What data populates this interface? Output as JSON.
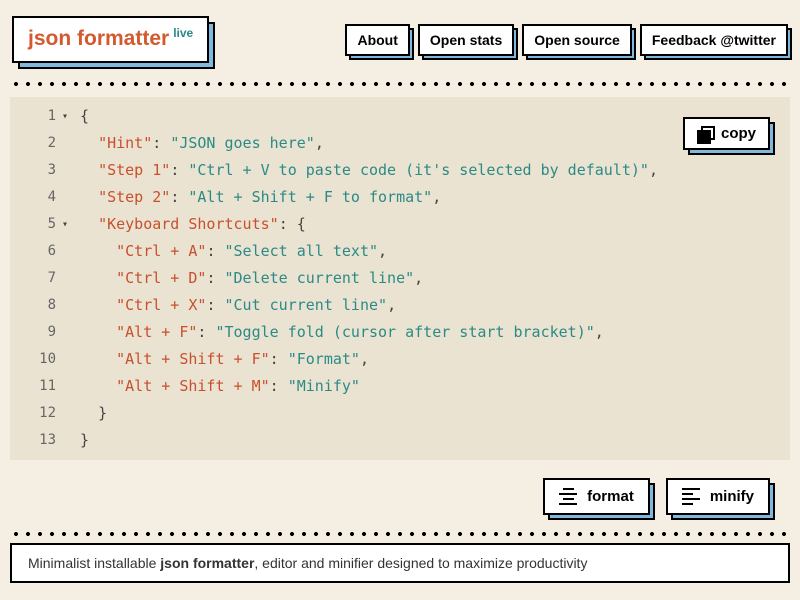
{
  "header": {
    "logo_text": "json formatter",
    "logo_sup": "live"
  },
  "nav": {
    "about": "About",
    "stats": "Open stats",
    "source": "Open source",
    "feedback": "Feedback @twitter"
  },
  "editor": {
    "copy_label": "copy",
    "lines": [
      {
        "num": "1",
        "fold": true,
        "indent": 0,
        "tokens": [
          {
            "t": "p",
            "v": "{"
          }
        ]
      },
      {
        "num": "2",
        "indent": 1,
        "tokens": [
          {
            "t": "k",
            "v": "\"Hint\""
          },
          {
            "t": "p",
            "v": ": "
          },
          {
            "t": "s",
            "v": "\"JSON goes here\""
          },
          {
            "t": "p",
            "v": ","
          }
        ]
      },
      {
        "num": "3",
        "indent": 1,
        "tokens": [
          {
            "t": "k",
            "v": "\"Step 1\""
          },
          {
            "t": "p",
            "v": ": "
          },
          {
            "t": "s",
            "v": "\"Ctrl + V to paste code (it's selected by default)\""
          },
          {
            "t": "p",
            "v": ","
          }
        ]
      },
      {
        "num": "4",
        "indent": 1,
        "tokens": [
          {
            "t": "k",
            "v": "\"Step 2\""
          },
          {
            "t": "p",
            "v": ": "
          },
          {
            "t": "s",
            "v": "\"Alt + Shift + F to format\""
          },
          {
            "t": "p",
            "v": ","
          }
        ]
      },
      {
        "num": "5",
        "fold": true,
        "indent": 1,
        "tokens": [
          {
            "t": "k",
            "v": "\"Keyboard Shortcuts\""
          },
          {
            "t": "p",
            "v": ": {"
          }
        ]
      },
      {
        "num": "6",
        "indent": 2,
        "tokens": [
          {
            "t": "k",
            "v": "\"Ctrl + A\""
          },
          {
            "t": "p",
            "v": ": "
          },
          {
            "t": "s",
            "v": "\"Select all text\""
          },
          {
            "t": "p",
            "v": ","
          }
        ]
      },
      {
        "num": "7",
        "indent": 2,
        "tokens": [
          {
            "t": "k",
            "v": "\"Ctrl + D\""
          },
          {
            "t": "p",
            "v": ": "
          },
          {
            "t": "s",
            "v": "\"Delete current line\""
          },
          {
            "t": "p",
            "v": ","
          }
        ]
      },
      {
        "num": "8",
        "indent": 2,
        "tokens": [
          {
            "t": "k",
            "v": "\"Ctrl + X\""
          },
          {
            "t": "p",
            "v": ": "
          },
          {
            "t": "s",
            "v": "\"Cut current line\""
          },
          {
            "t": "p",
            "v": ","
          }
        ]
      },
      {
        "num": "9",
        "indent": 2,
        "tokens": [
          {
            "t": "k",
            "v": "\"Alt + F\""
          },
          {
            "t": "p",
            "v": ": "
          },
          {
            "t": "s",
            "v": "\"Toggle fold (cursor after start bracket)\""
          },
          {
            "t": "p",
            "v": ","
          }
        ]
      },
      {
        "num": "10",
        "indent": 2,
        "tokens": [
          {
            "t": "k",
            "v": "\"Alt + Shift + F\""
          },
          {
            "t": "p",
            "v": ": "
          },
          {
            "t": "s",
            "v": "\"Format\""
          },
          {
            "t": "p",
            "v": ","
          }
        ]
      },
      {
        "num": "11",
        "indent": 2,
        "tokens": [
          {
            "t": "k",
            "v": "\"Alt + Shift + M\""
          },
          {
            "t": "p",
            "v": ": "
          },
          {
            "t": "s",
            "v": "\"Minify\""
          }
        ]
      },
      {
        "num": "12",
        "indent": 1,
        "tokens": [
          {
            "t": "p",
            "v": "}"
          }
        ]
      },
      {
        "num": "13",
        "indent": 0,
        "tokens": [
          {
            "t": "p",
            "v": "}"
          }
        ]
      }
    ]
  },
  "actions": {
    "format": "format",
    "minify": "minify"
  },
  "footer": {
    "prefix": "Minimalist installable ",
    "bold": "json formatter",
    "suffix": ", editor and minifier designed to maximize productivity"
  }
}
